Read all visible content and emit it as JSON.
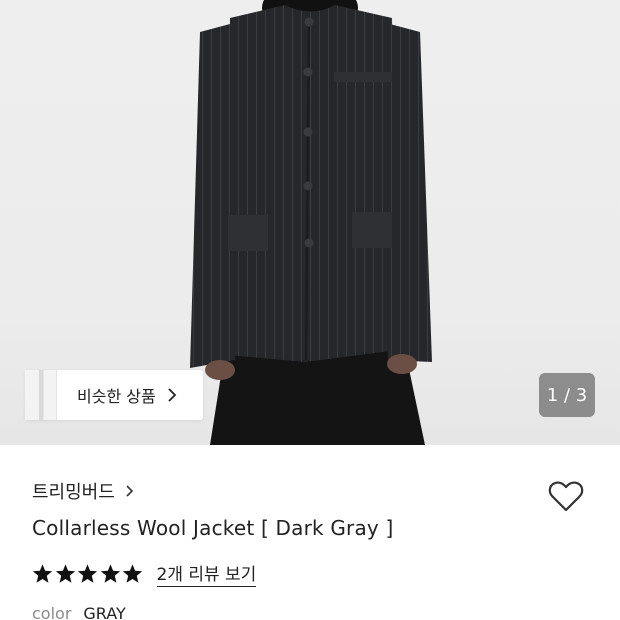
{
  "hero": {
    "similar_label": "비슷한 상품",
    "counter": "1 / 3"
  },
  "product": {
    "brand": "트리밍버드",
    "title": "Collarless Wool Jacket [ Dark Gray ]",
    "rating": 5,
    "review_link": "2개 리뷰 보기",
    "option_label": "color",
    "option_value": "GRAY"
  },
  "icons": {
    "chevron": "chevron-right-icon",
    "heart": "heart-outline-icon",
    "star": "star-filled-icon"
  },
  "colors": {
    "text": "#222222",
    "muted": "#8a8a8a",
    "counter_bg": "#6e6e6e"
  }
}
